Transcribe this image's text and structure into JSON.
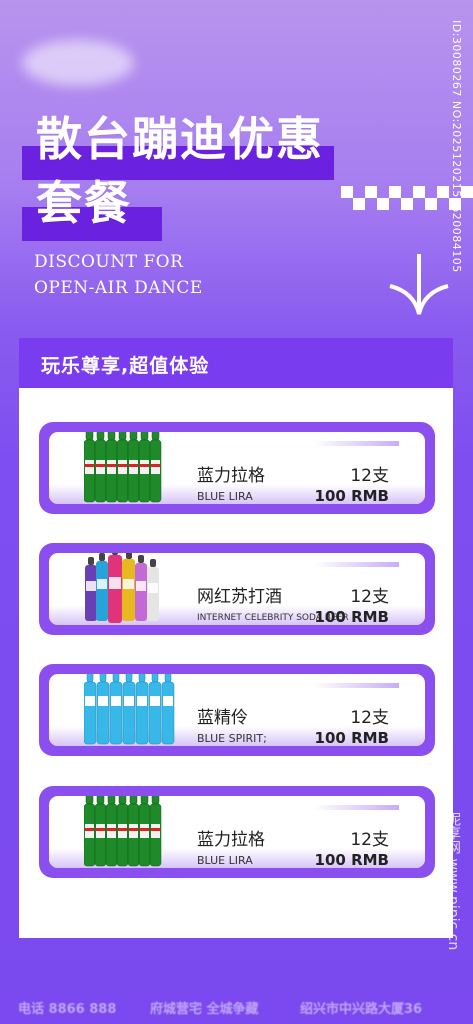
{
  "title": {
    "line1": "散台蹦迪优惠",
    "line2": "套餐"
  },
  "subtitle": {
    "line1": "DISCOUNT FOR",
    "line2": "OPEN-AIR DANCE"
  },
  "watermark_id": "ID:30080267 NO:20251202154620084105",
  "watermark_site": "昵享网 www.nipic.cn",
  "panel": {
    "title": "玩乐尊享,超值体验"
  },
  "items": [
    {
      "name": "蓝力拉格",
      "sub": "BLUE LIRA",
      "qty": "12支",
      "price": "100 RMB",
      "bottle_type": "green-beer"
    },
    {
      "name": "网红苏打酒",
      "sub": "INTERNET CELEBRITY SODA BEER",
      "qty": "12支",
      "price": "100 RMB",
      "bottle_type": "colorful-soda"
    },
    {
      "name": "蓝精伶",
      "sub": "BLUE SPIRIT;",
      "qty": "12支",
      "price": "100 RMB",
      "bottle_type": "blue-rio"
    },
    {
      "name": "蓝力拉格",
      "sub": "BLUE LIRA",
      "qty": "12支",
      "price": "100 RMB",
      "bottle_type": "green-beer"
    }
  ],
  "footer": {
    "phone": "电话 8866 888",
    "slogan": "府城营宅 全城争藏",
    "address": "绍兴市中兴路大厦36"
  },
  "colors": {
    "accent": "#7a3cef",
    "item_border": "#8b4ff0",
    "bg_top": "#b894ee",
    "bg_bottom": "#7b49ef"
  }
}
